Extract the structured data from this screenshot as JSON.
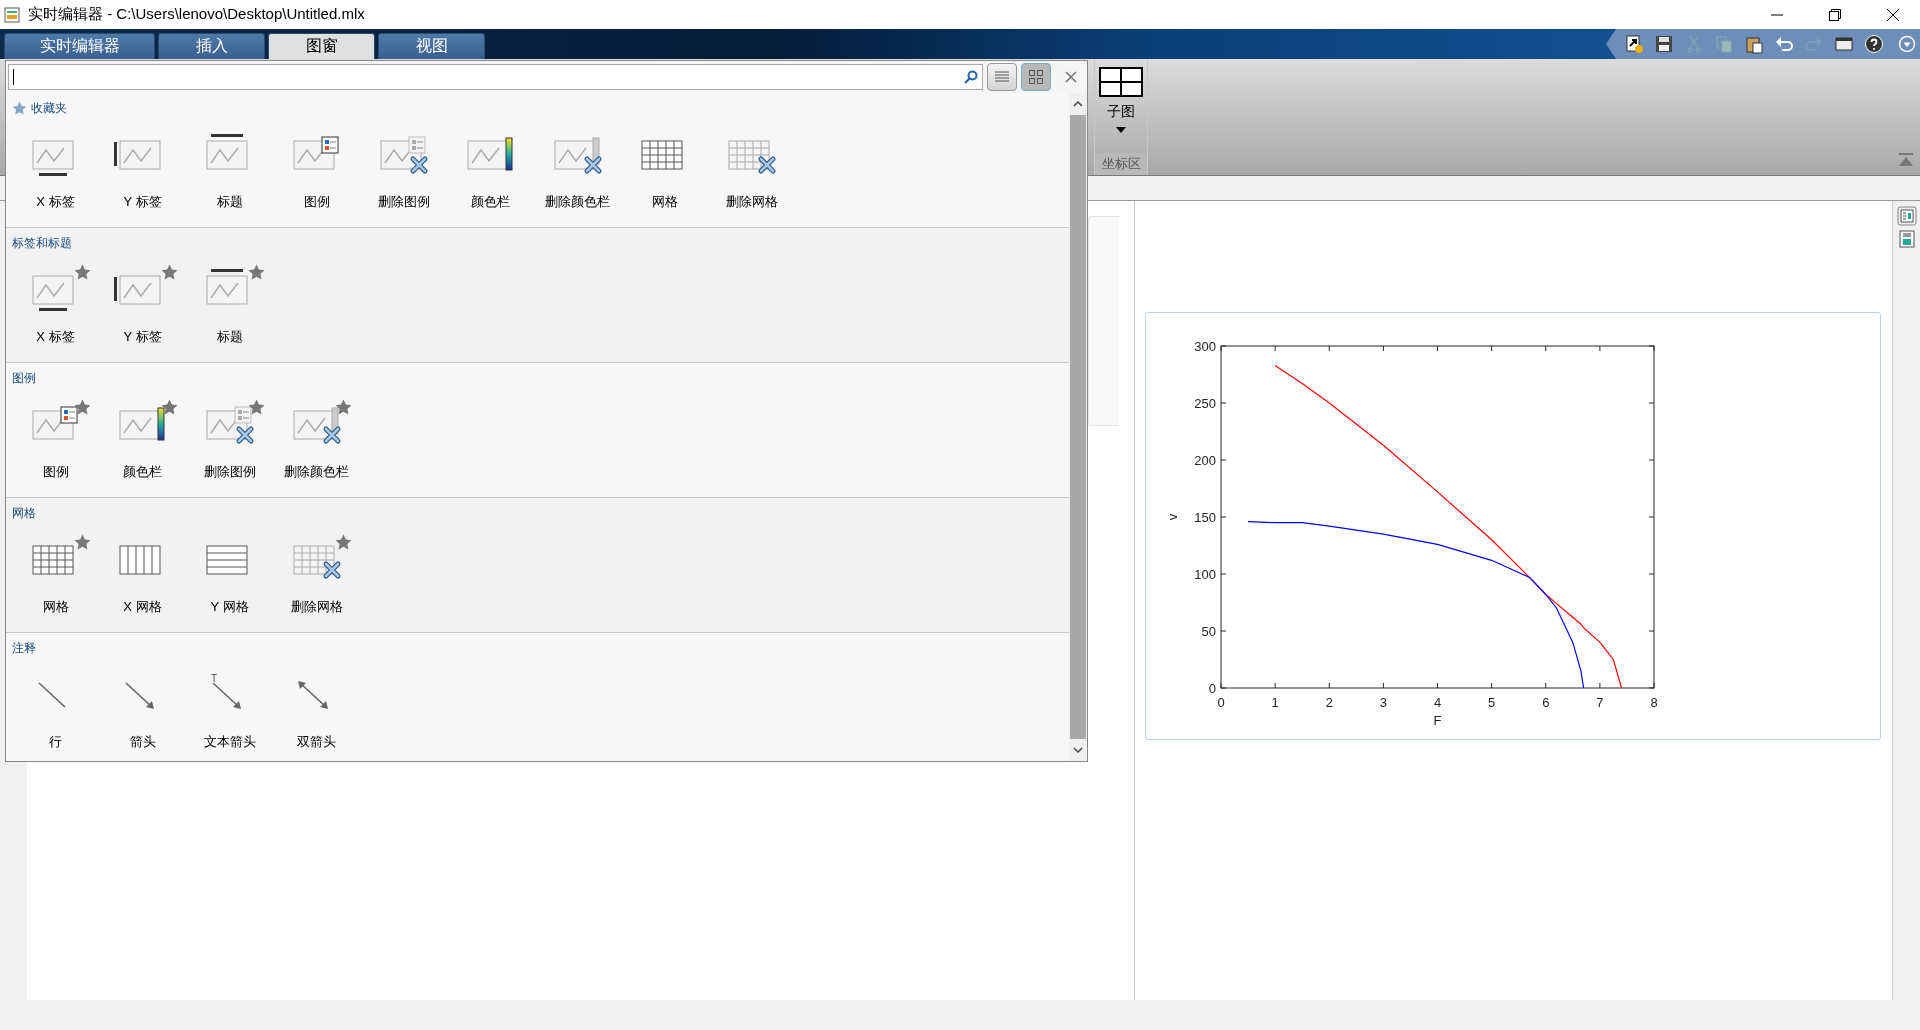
{
  "window": {
    "title": "实时编辑器 - C:\\Users\\lenovo\\Desktop\\Untitled.mlx"
  },
  "tabs": [
    {
      "label": "实时编辑器",
      "selected": false
    },
    {
      "label": "插入",
      "selected": false
    },
    {
      "label": "图窗",
      "selected": true
    },
    {
      "label": "视图",
      "selected": false
    }
  ],
  "ribbon": {
    "button": {
      "label": "子图"
    },
    "group_label": "坐标区"
  },
  "gallery": {
    "search": {
      "view_buttons": [
        {
          "kind": "list",
          "selected": false
        },
        {
          "kind": "grid",
          "selected": true
        }
      ]
    },
    "sections": [
      {
        "title": "收藏夹",
        "kind": "favorites",
        "items": [
          {
            "label": "X 标签",
            "kind": "xlabel",
            "starred": false
          },
          {
            "label": "Y 标签",
            "kind": "ylabel",
            "starred": false
          },
          {
            "label": "标题",
            "kind": "title",
            "starred": false
          },
          {
            "label": "图例",
            "kind": "legend",
            "starred": false
          },
          {
            "label": "删除图例",
            "kind": "dellegend",
            "starred": false
          },
          {
            "label": "颜色栏",
            "kind": "colorbar",
            "starred": false
          },
          {
            "label": "删除颜色栏",
            "kind": "delcolorbar",
            "starred": false
          },
          {
            "label": "网格",
            "kind": "grid",
            "starred": false
          },
          {
            "label": "删除网格",
            "kind": "delgrid",
            "starred": false
          }
        ]
      },
      {
        "title": "标签和标题",
        "kind": "plain",
        "items": [
          {
            "label": "X 标签",
            "kind": "xlabel",
            "starred": true
          },
          {
            "label": "Y 标签",
            "kind": "ylabel",
            "starred": true
          },
          {
            "label": "标题",
            "kind": "title",
            "starred": true
          }
        ]
      },
      {
        "title": "图例",
        "kind": "plain",
        "items": [
          {
            "label": "图例",
            "kind": "legend",
            "starred": true
          },
          {
            "label": "颜色栏",
            "kind": "colorbar",
            "starred": true
          },
          {
            "label": "删除图例",
            "kind": "dellegend",
            "starred": true
          },
          {
            "label": "删除颜色栏",
            "kind": "delcolorbar",
            "starred": true
          }
        ]
      },
      {
        "title": "网格",
        "kind": "plain",
        "items": [
          {
            "label": "网格",
            "kind": "grid",
            "starred": true
          },
          {
            "label": "X 网格",
            "kind": "xgrid",
            "starred": false
          },
          {
            "label": "Y 网格",
            "kind": "ygrid",
            "starred": false
          },
          {
            "label": "删除网格",
            "kind": "delgrid",
            "starred": true
          }
        ]
      },
      {
        "title": "注释",
        "kind": "plain",
        "items": [
          {
            "label": "行",
            "kind": "line",
            "starred": false
          },
          {
            "label": "箭头",
            "kind": "arrow",
            "starred": false
          },
          {
            "label": "文本箭头",
            "kind": "textarrow",
            "glyph": "T",
            "starred": false
          },
          {
            "label": "双箭头",
            "kind": "doublearrow",
            "starred": false
          }
        ]
      }
    ]
  },
  "output": {
    "chart_data": {
      "type": "line",
      "xlabel": "F",
      "ylabel": "v",
      "x": [
        0.5,
        1,
        1.5,
        2,
        3,
        4,
        5,
        5.7,
        6,
        6.2,
        6.5,
        6.65,
        6.7,
        7,
        7.25,
        7.4
      ],
      "series": [
        {
          "color": "#ff0000",
          "values": [
            null,
            283,
            267,
            250,
            213,
            172,
            130,
            97,
            82,
            74,
            62,
            56,
            53,
            40,
            25,
            0
          ]
        },
        {
          "color": "#0000ff",
          "values": [
            146,
            145,
            145,
            142,
            135,
            126,
            112,
            97,
            82,
            70,
            40,
            15,
            0,
            null,
            null,
            null
          ]
        }
      ],
      "xlim": [
        0,
        8
      ],
      "ylim": [
        0,
        300
      ],
      "xticks": [
        0,
        1,
        2,
        3,
        4,
        5,
        6,
        7,
        8
      ],
      "yticks": [
        0,
        50,
        100,
        150,
        200,
        250,
        300
      ]
    }
  }
}
